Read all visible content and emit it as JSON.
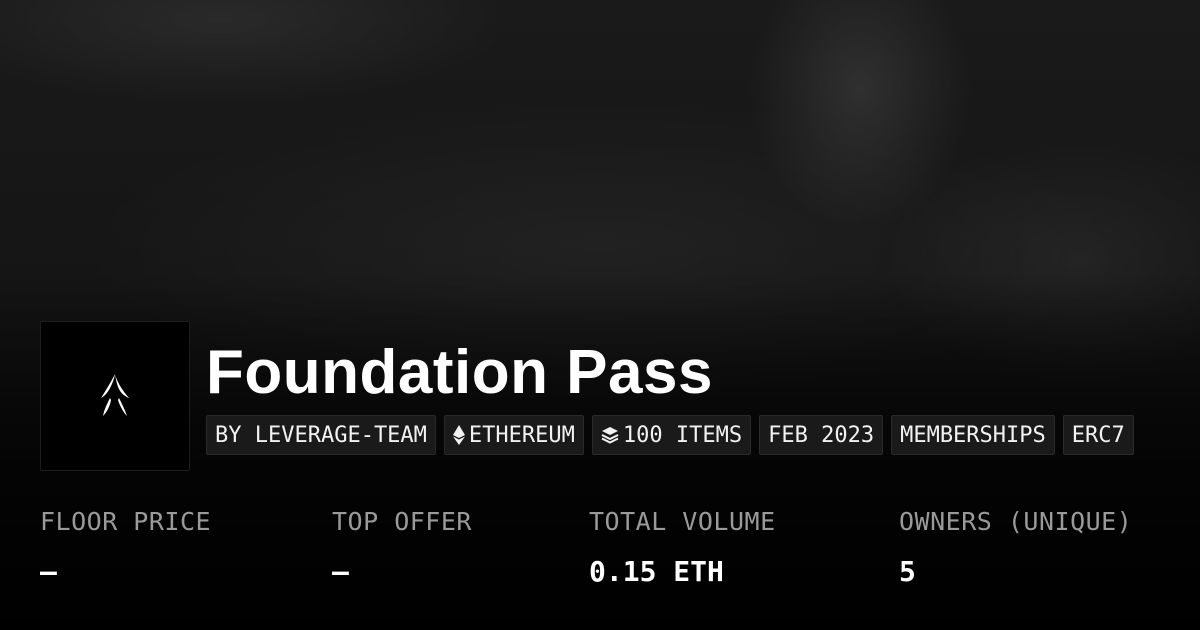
{
  "collection": {
    "title": "Foundation Pass",
    "tags": [
      {
        "label": "BY LEVERAGE-TEAM",
        "icon": ""
      },
      {
        "label": "ETHEREUM",
        "icon": "ethereum-icon"
      },
      {
        "label": "100 ITEMS",
        "icon": "layers-icon"
      },
      {
        "label": "FEB 2023",
        "icon": ""
      },
      {
        "label": "MEMBERSHIPS",
        "icon": ""
      },
      {
        "label": "ERC7",
        "icon": ""
      }
    ]
  },
  "stats": [
    {
      "label": "FLOOR PRICE",
      "value": "–"
    },
    {
      "label": "TOP OFFER",
      "value": "–"
    },
    {
      "label": "TOTAL VOLUME",
      "value": "0.15 ETH"
    },
    {
      "label": "OWNERS (UNIQUE)",
      "value": "5"
    }
  ],
  "colors": {
    "background": "#000000",
    "tag_background": "#1a1a1a",
    "label_gray": "#9a9a9a",
    "text": "#ffffff"
  }
}
